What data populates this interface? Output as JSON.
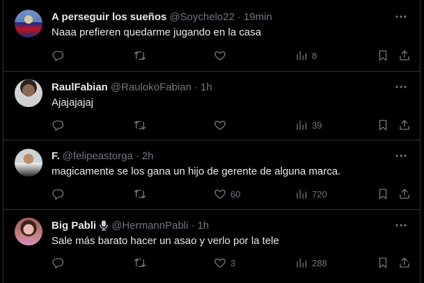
{
  "colors": {
    "background": "#000000",
    "divider": "#2f3336",
    "primary_text": "#e7e9ea",
    "secondary_text": "#71767b"
  },
  "tweets": [
    {
      "name": "A perseguir los sueños",
      "handle": "@Soychelo22",
      "separator": "·",
      "time": "19min",
      "text": "Naaa prefieren quedarme jugando en la casa",
      "replies": "",
      "retweets": "",
      "likes": "",
      "views": "8"
    },
    {
      "name": "RaulFabian",
      "handle": "@RaulokoFabian",
      "separator": "·",
      "time": "1h",
      "text": "Ajajajajaj",
      "replies": "",
      "retweets": "",
      "likes": "",
      "views": "39"
    },
    {
      "name": "F.",
      "handle": "@felipeastorga",
      "separator": "·",
      "time": "2h",
      "text": "magicamente se los gana un hijo de gerente de alguna marca.",
      "replies": "",
      "retweets": "",
      "likes": "60",
      "views": "720"
    },
    {
      "name": "Big Pabli",
      "handle": "@HermannPabli",
      "separator": "·",
      "time": "1h",
      "text": "Sale más barato hacer un asao y verlo por la tele",
      "replies": "",
      "retweets": "",
      "likes": "3",
      "views": "288"
    }
  ],
  "icons": {
    "reply": "reply-icon",
    "retweet": "retweet-icon",
    "like": "heart-icon",
    "views": "views-icon",
    "bookmark": "bookmark-icon",
    "share": "share-icon",
    "more": "more-icon",
    "mic": "microphone-icon"
  }
}
